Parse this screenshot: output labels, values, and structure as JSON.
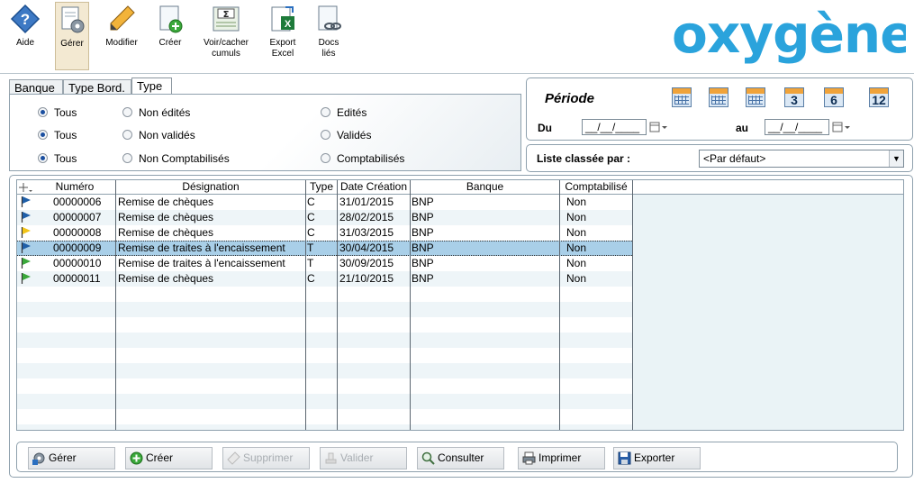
{
  "toolbar": {
    "buttons": [
      {
        "label": "Aide",
        "icon": "help-icon"
      },
      {
        "label": "Gérer",
        "icon": "manage-icon"
      },
      {
        "label": "Modifier",
        "icon": "pencil-icon"
      },
      {
        "label": "Créer",
        "icon": "new-document-icon"
      },
      {
        "label": "Voir/cacher\ncumuls",
        "icon": "sum-icon"
      },
      {
        "label": "Export\nExcel",
        "icon": "excel-icon"
      },
      {
        "label": "Docs\nliés",
        "icon": "linked-docs-icon"
      }
    ]
  },
  "logo": {
    "text": "oxygène",
    "color": "#2aa3dc"
  },
  "tabs": [
    "Banque",
    "Type Bord.",
    "Type"
  ],
  "filters": {
    "col1": [
      "Tous",
      "Tous",
      "Tous"
    ],
    "col2": [
      "Non édités",
      "Non validés",
      "Non Comptabilisés"
    ],
    "col3": [
      "Edités",
      "Validés",
      "Comptabilisés"
    ]
  },
  "periode": {
    "title": "Période",
    "du_label": "Du",
    "au_label": "au",
    "du_value": "__/__/____",
    "au_value": "__/__/____",
    "quick": [
      "",
      "",
      "",
      "3",
      "6",
      "12"
    ]
  },
  "sort": {
    "label": "Liste classée par :",
    "value": "<Par défaut>"
  },
  "table": {
    "columns": [
      "Numéro",
      "Désignation",
      "Type",
      "Date Création",
      "Banque",
      "Comptabilisé"
    ],
    "rows": [
      {
        "flag": "#1f5fa8",
        "numero": "00000006",
        "designation": "Remise de chèques",
        "type": "C",
        "date": "31/01/2015",
        "banque": "BNP",
        "compta": "Non"
      },
      {
        "flag": "#1f5fa8",
        "numero": "00000007",
        "designation": "Remise de chèques",
        "type": "C",
        "date": "28/02/2015",
        "banque": "BNP",
        "compta": "Non"
      },
      {
        "flag": "#f2c418",
        "numero": "00000008",
        "designation": "Remise de chèques",
        "type": "C",
        "date": "31/03/2015",
        "banque": "BNP",
        "compta": "Non"
      },
      {
        "flag": "#1f5fa8",
        "numero": "00000009",
        "designation": "Remise de traites à l'encaissement",
        "type": "T",
        "date": "30/04/2015",
        "banque": "BNP",
        "compta": "Non",
        "selected": true
      },
      {
        "flag": "#3aa83a",
        "numero": "00000010",
        "designation": "Remise de traites à l'encaissement",
        "type": "T",
        "date": "30/09/2015",
        "banque": "BNP",
        "compta": "Non"
      },
      {
        "flag": "#3aa83a",
        "numero": "00000011",
        "designation": "Remise de chèques",
        "type": "C",
        "date": "21/10/2015",
        "banque": "BNP",
        "compta": "Non"
      }
    ]
  },
  "actions": [
    {
      "label": "Gérer",
      "icon": "gear-icon",
      "enabled": true
    },
    {
      "label": "Créer",
      "icon": "add-icon",
      "enabled": true
    },
    {
      "label": "Supprimer",
      "icon": "eraser-icon",
      "enabled": false
    },
    {
      "label": "Valider",
      "icon": "stamp-icon",
      "enabled": false
    },
    {
      "label": "Consulter",
      "icon": "magnifier-icon",
      "enabled": true
    },
    {
      "label": "Imprimer",
      "icon": "printer-icon",
      "enabled": true
    },
    {
      "label": "Exporter",
      "icon": "floppy-icon",
      "enabled": true
    }
  ]
}
